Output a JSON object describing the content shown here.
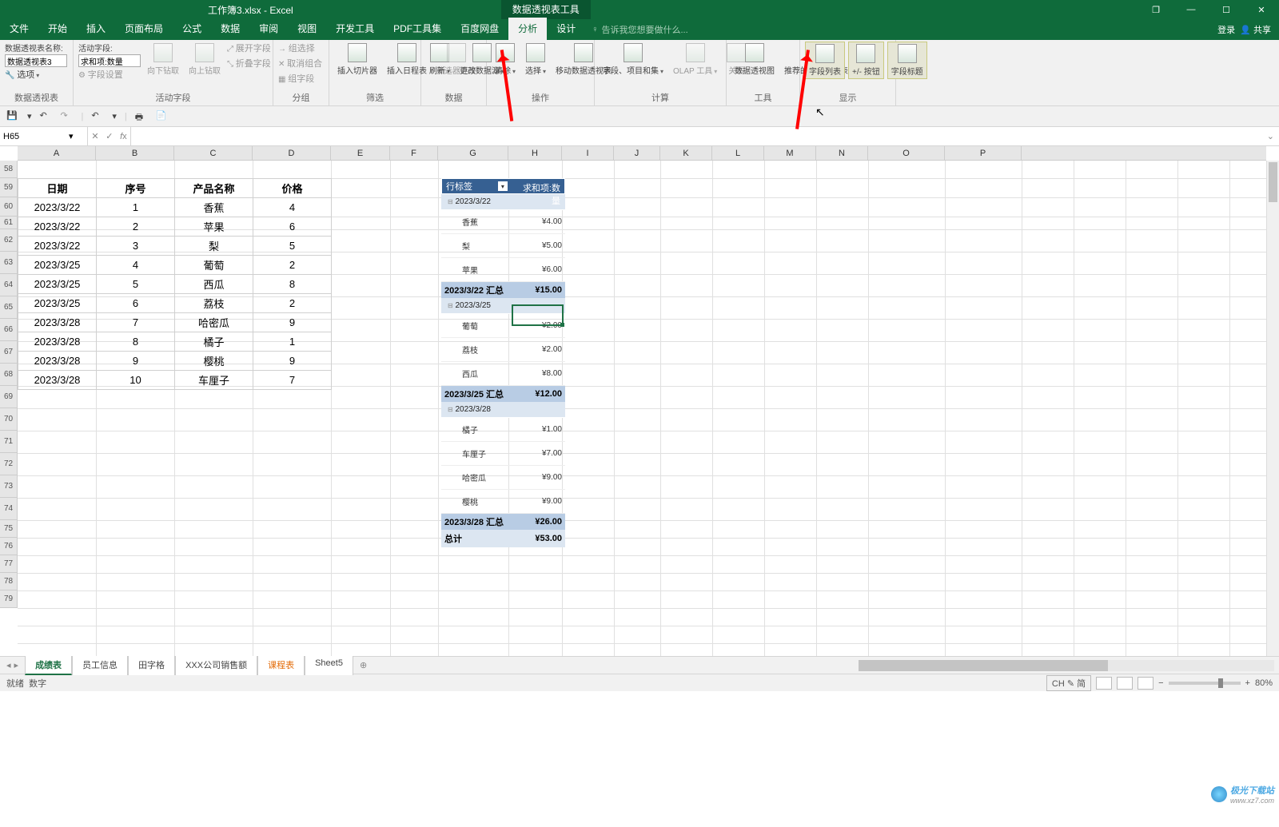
{
  "title_doc": "工作簿3.xlsx - Excel",
  "title_context": "数据透视表工具",
  "win": {
    "restore": "❐",
    "min": "—",
    "max": "☐",
    "close": "✕"
  },
  "menutabs": [
    "文件",
    "开始",
    "插入",
    "页面布局",
    "公式",
    "数据",
    "审阅",
    "视图",
    "开发工具",
    "PDF工具集",
    "百度网盘",
    "分析",
    "设计"
  ],
  "active_tab": "分析",
  "tell_me": "告诉我您想要做什么...",
  "login": "登录",
  "share": "共享",
  "ribbon": {
    "pt_name_lbl": "数据透视表名称:",
    "pt_name_val": "数据透视表3",
    "options": "选项",
    "grp_pt": "数据透视表",
    "active_field_lbl": "活动字段:",
    "active_field_val": "求和项:数量",
    "field_settings": "字段设置",
    "drill_down": "向下钻取",
    "drill_up": "向上钻取",
    "expand": "展开字段",
    "collapse": "折叠字段",
    "grp_af": "活动字段",
    "group_sel": "组选择",
    "ungroup": "取消组合",
    "group_field": "组字段",
    "grp_group": "分组",
    "slicer": "插入切片器",
    "timeline": "插入日程表",
    "filter_conn": "筛选器连接",
    "grp_filter": "筛选",
    "refresh": "刷新",
    "change_src": "更改数据源",
    "grp_data": "数据",
    "clear": "清除",
    "select": "选择",
    "move": "移动数据透视表",
    "grp_actions": "操作",
    "calc_fields": "字段、项目和集",
    "olap": "OLAP 工具",
    "relations": "关系",
    "grp_calc": "计算",
    "pivot_chart": "数据透视图",
    "recommend": "推荐的数据透视表",
    "grp_tools": "工具",
    "field_list": "字段列表",
    "pm_buttons": "+/- 按钮",
    "field_headers": "字段标题",
    "grp_show": "显示"
  },
  "namebox": "H65",
  "columns": [
    "A",
    "B",
    "C",
    "D",
    "E",
    "F",
    "G",
    "H",
    "I",
    "J",
    "K",
    "L",
    "M",
    "N",
    "O",
    "P"
  ],
  "rows": [
    "58",
    "59",
    "60",
    "61",
    "62",
    "63",
    "64",
    "65",
    "66",
    "67",
    "68",
    "69",
    "70",
    "71",
    "72",
    "73",
    "74",
    "75",
    "76",
    "77",
    "78",
    "79"
  ],
  "src_headers": [
    "日期",
    "序号",
    "产品名称",
    "价格"
  ],
  "src_data": [
    [
      "2023/3/22",
      "1",
      "香蕉",
      "4"
    ],
    [
      "2023/3/22",
      "2",
      "苹果",
      "6"
    ],
    [
      "2023/3/22",
      "3",
      "梨",
      "5"
    ],
    [
      "2023/3/25",
      "4",
      "葡萄",
      "2"
    ],
    [
      "2023/3/25",
      "5",
      "西瓜",
      "8"
    ],
    [
      "2023/3/25",
      "6",
      "荔枝",
      "2"
    ],
    [
      "2023/3/28",
      "7",
      "哈密瓜",
      "9"
    ],
    [
      "2023/3/28",
      "8",
      "橘子",
      "1"
    ],
    [
      "2023/3/28",
      "9",
      "樱桃",
      "9"
    ],
    [
      "2023/3/28",
      "10",
      "车厘子",
      "7"
    ]
  ],
  "pivot": {
    "hdr_row": "行标签",
    "hdr_val": "求和项:数量",
    "groups": [
      {
        "date": "2023/3/22",
        "items": [
          [
            "香蕉",
            "¥4.00"
          ],
          [
            "梨",
            "¥5.00"
          ],
          [
            "苹果",
            "¥6.00"
          ]
        ],
        "subtotal": [
          "2023/3/22 汇总",
          "¥15.00"
        ]
      },
      {
        "date": "2023/3/25",
        "items": [
          [
            "葡萄",
            "¥2.00"
          ],
          [
            "荔枝",
            "¥2.00"
          ],
          [
            "西瓜",
            "¥8.00"
          ]
        ],
        "subtotal": [
          "2023/3/25 汇总",
          "¥12.00"
        ]
      },
      {
        "date": "2023/3/28",
        "items": [
          [
            "橘子",
            "¥1.00"
          ],
          [
            "车厘子",
            "¥7.00"
          ],
          [
            "哈密瓜",
            "¥9.00"
          ],
          [
            "樱桃",
            "¥9.00"
          ]
        ],
        "subtotal": [
          "2023/3/28 汇总",
          "¥26.00"
        ]
      }
    ],
    "total": [
      "总计",
      "¥53.00"
    ]
  },
  "sheets": [
    "成绩表",
    "员工信息",
    "田字格",
    "XXX公司销售额",
    "课程表",
    "Sheet5"
  ],
  "active_sheet": "成绩表",
  "orange_sheet": "课程表",
  "status": {
    "ready": "就绪",
    "num": "数字",
    "ime": "CH ✎ 简",
    "zoom": "80%"
  },
  "watermark": "极光下载站",
  "watermark_url": "www.xz7.com"
}
